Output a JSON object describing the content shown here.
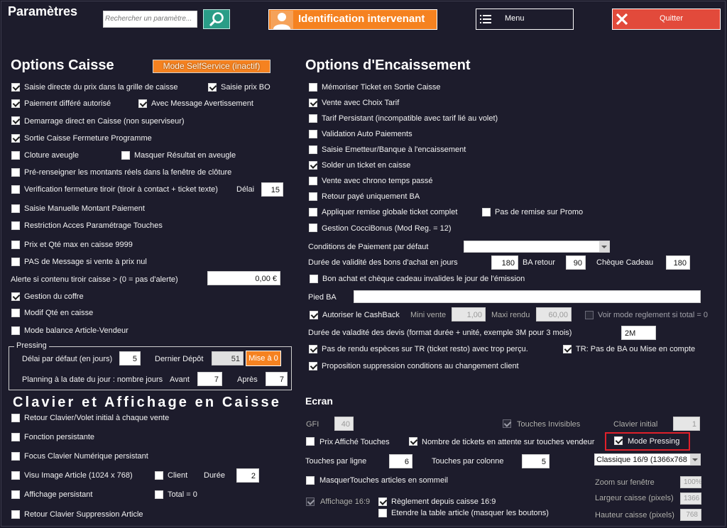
{
  "header": {
    "title": "Paramètres",
    "search_placeholder": "Rechercher un paramètre...",
    "identification_label": "Identification intervenant",
    "menu_label": "Menu",
    "quit_label": "Quitter"
  },
  "caisse": {
    "title": "Options Caisse",
    "mode_selfservice": "Mode SelfService (inactif)",
    "saisie_directe": "Saisie directe du prix dans la grille de caisse",
    "saisie_prix_bo": "Saisie prix BO",
    "paiement_differe": "Paiement différé autorisé",
    "avec_message": "Avec Message Avertissement",
    "demarrage_direct": "Demarrage direct en Caisse (non superviseur)",
    "sortie_caisse": "Sortie Caisse Fermeture Programme",
    "cloture_aveugle": "Cloture aveugle",
    "masquer_resultat": "Masquer Résultat en aveugle",
    "pre_renseigner": "Pré-renseigner les montants réels dans la fenêtre de clôture",
    "verification_tiroir": "Verification fermeture tiroir (tiroir à contact + ticket texte)",
    "delai_label": "Délai",
    "delai_value": "15",
    "saisie_manuelle": "Saisie Manuelle Montant Paiement",
    "restriction_acces": "Restriction Acces Paramétrage Touches",
    "prix_qte_max": "Prix et Qté max en caisse 9999",
    "pas_message": "PAS de Message si vente à prix nul",
    "alerte_label": "Alerte si contenu tiroir caisse > (0 = pas d'alerte)",
    "alerte_value": "0,00 €",
    "gestion_coffre": "Gestion du coffre",
    "modif_qte": "Modif Qté en caisse",
    "mode_balance": "Mode balance Article-Vendeur"
  },
  "pressing": {
    "title": "Pressing",
    "delai_label": "Délai par défaut (en jours)",
    "delai_value": "5",
    "dernier_depot_label": "Dernier Dépôt",
    "dernier_depot_value": "51",
    "mise_a_0": "Mise à 0",
    "planning_label": "Planning  à la date du jour : nombre jours",
    "avant_label": "Avant",
    "avant_value": "7",
    "apres_label": "Après",
    "apres_value": "7"
  },
  "clavier": {
    "title": "Clavier et Affichage en Caisse",
    "retour_clavier": "Retour Clavier/Volet initial à chaque vente",
    "fonction_persistante": "Fonction persistante",
    "focus_clavier": "Focus Clavier Numérique persistant",
    "visu_image": "Visu Image Article (1024 x 768)",
    "client": "Client",
    "duree_label": "Durée",
    "duree_value": "2",
    "affichage_persistant": "Affichage persistant",
    "total_zero": "Total = 0",
    "retour_suppression": "Retour Clavier Suppression Article"
  },
  "encaissement": {
    "title": "Options d'Encaissement",
    "memoriser_ticket": "Mémoriser Ticket en Sortie Caisse",
    "vente_choix_tarif": "Vente avec Choix Tarif",
    "tarif_persistant": "Tarif Persistant (incompatible avec tarif lié au volet)",
    "validation_auto": "Validation Auto Paiements",
    "saisie_emetteur": "Saisie Emetteur/Banque à l'encaissement",
    "solder_ticket": "Solder un ticket en caisse",
    "vente_chrono": "Vente avec chrono temps passé",
    "retour_paye": "Retour payé uniquement BA",
    "appliquer_remise": "Appliquer remise globale ticket complet",
    "pas_remise_promo": "Pas de remise sur Promo",
    "gestion_coccibonus": "Gestion CocciBonus (Mod Reg. = 12)",
    "conditions_label": "Conditions de Paiement par défaut",
    "duree_bons_label": "Durée de validité des bons d'achat en jours",
    "duree_bons_value": "180",
    "ba_retour_label": "BA retour",
    "ba_retour_value": "90",
    "cheque_cadeau_label": "Chèque Cadeau",
    "cheque_cadeau_value": "180",
    "bon_achat_invalide": "Bon achat et chèque cadeau invalides le jour de l'émission",
    "pied_ba_label": "Pied BA",
    "autoriser_cashback": "Autoriser le CashBack",
    "mini_vente_label": "Mini vente",
    "mini_vente_value": "1,00",
    "maxi_rendu_label": "Maxi rendu",
    "maxi_rendu_value": "60,00",
    "voir_mode": "Voir mode reglement si total = 0",
    "duree_devis_label": "Durée de valadité des devis (format durée + unité, exemple 3M pour 3 mois)",
    "duree_devis_value": "2M",
    "pas_rendu": "Pas de rendu espèces sur TR (ticket resto) avec trop perçu.",
    "tr_pas_ba": "TR: Pas de BA ou Mise en compte",
    "proposition_suppression": "Proposition suppression conditions au changement client"
  },
  "ecran": {
    "title": "Ecran",
    "gfi_label": "GFI",
    "gfi_value": "40",
    "touches_invisibles": "Touches Invisibles",
    "clavier_initial_label": "Clavier initial",
    "clavier_initial_value": "1",
    "prix_affiche": "Prix Affiché Touches",
    "nombre_tickets": "Nombre de tickets en attente sur touches vendeur",
    "mode_pressing": "Mode Pressing",
    "touches_ligne_label": "Touches par ligne",
    "touches_ligne_value": "6",
    "touches_colonne_label": "Touches par colonne",
    "touches_colonne_value": "5",
    "resolution_value": "Classique 16/9 (1366x768",
    "masquer_touches": "MasquerTouches articles en sommeil",
    "zoom_label": "Zoom sur fenêtre",
    "zoom_value": "100%",
    "affichage_169": "Affichage 16:9",
    "reglement_169": "Règlement depuis caisse 16:9",
    "etendre_table": "Etendre la table article (masquer les boutons)",
    "largeur_label": "Largeur caisse (pixels)",
    "largeur_value": "1366",
    "hauteur_label": "Hauteur caisse (pixels)",
    "hauteur_value": "768"
  },
  "colors": {
    "background": "#1d1c2c",
    "accent_orange": "#f58220",
    "search_green": "#2a9d87",
    "quit_red": "#e24a3b",
    "highlight_red": "#e0202a"
  }
}
